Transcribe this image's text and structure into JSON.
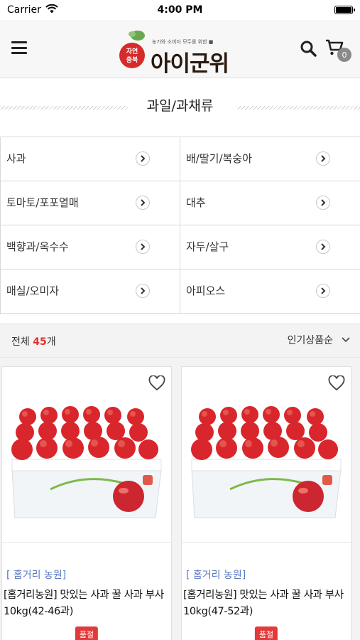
{
  "status_bar": {
    "carrier": "Carrier",
    "time": "4:00 PM",
    "battery_level": 1.0
  },
  "header": {
    "logo_emblem_text": "자연 충북",
    "logo_tagline": "농가와 소비자 모두를 위한 ■",
    "logo_brand": "아이군위",
    "cart_count": "0"
  },
  "section_title": "과일/과채류",
  "categories": [
    {
      "label": "사과"
    },
    {
      "label": "배/딸기/복숭아"
    },
    {
      "label": "토마토/포포열매"
    },
    {
      "label": "대추"
    },
    {
      "label": "백향과/옥수수"
    },
    {
      "label": "자두/살구"
    },
    {
      "label": "매실/오미자"
    },
    {
      "label": "아피오스"
    }
  ],
  "listing": {
    "total_prefix": "전체 ",
    "total_count": "45",
    "total_suffix": "개",
    "sort_label": "인기상품순"
  },
  "products": [
    {
      "vendor": "[ 홈거리 농원]",
      "name": "[홈거리농원] 맛있는 사과 꿀 사과 부사 10kg(42-46과)",
      "status": "품절"
    },
    {
      "vendor": "[ 홈거리 농원]",
      "name": "[홈거리농원] 맛있는 사과 꿀 사과 부사 10kg(47-52과)",
      "status": "품절"
    }
  ],
  "colors": {
    "accent_red": "#e0322d",
    "vendor_blue": "#5a77c2",
    "badge_gray": "#8a8a8a"
  },
  "icons": [
    "wifi-icon",
    "battery-icon",
    "menu-icon",
    "search-icon",
    "cart-icon",
    "chevron-right-icon",
    "chevron-down-icon",
    "heart-outline-icon"
  ]
}
